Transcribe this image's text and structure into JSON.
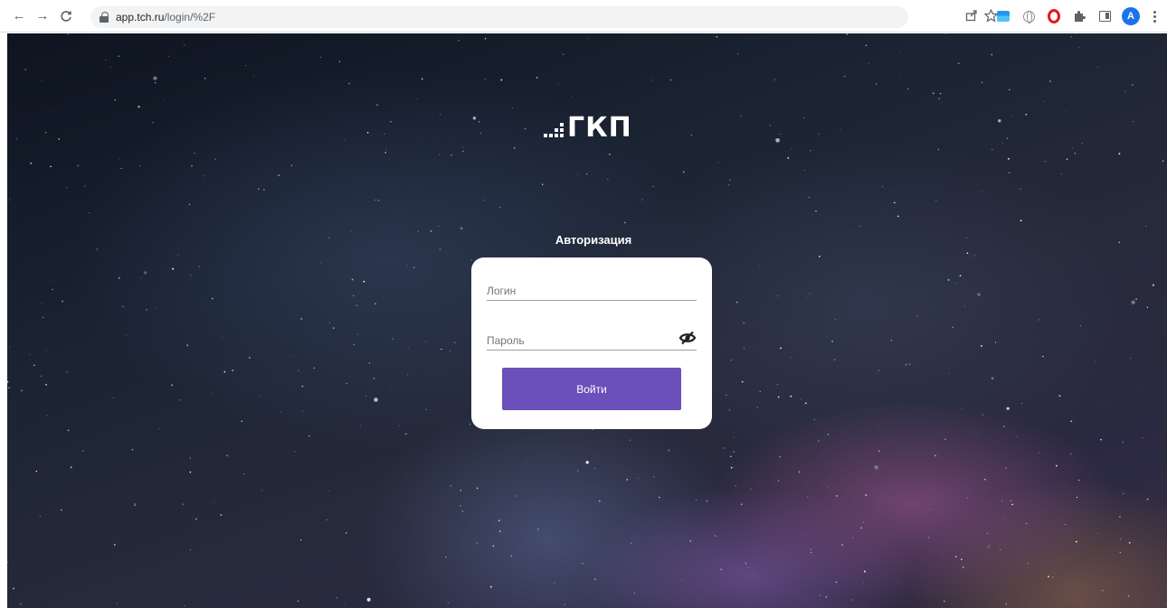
{
  "browser": {
    "url_host": "app.tch.ru",
    "url_path": "/login/%2F",
    "avatar_letter": "A",
    "icons": {
      "back": "arrow-left-icon",
      "forward": "arrow-right-icon",
      "reload": "reload-icon",
      "lock": "lock-icon",
      "share": "share-icon",
      "bookmark": "star-icon",
      "extensions": [
        "image-extension-icon",
        "globe-extension-icon",
        "opera-icon",
        "puzzle-icon",
        "side-panel-icon"
      ],
      "menu": "kebab-menu-icon"
    }
  },
  "page": {
    "logo_text": "ГКП",
    "auth_title": "Авторизация",
    "form": {
      "login_placeholder": "Логин",
      "password_placeholder": "Пароль",
      "submit_label": "Войти",
      "password_toggle_icon": "eye-off-icon"
    },
    "colors": {
      "accent": "#6b4fbb",
      "card": "#ffffff",
      "text_on_dark": "#ffffff"
    }
  }
}
